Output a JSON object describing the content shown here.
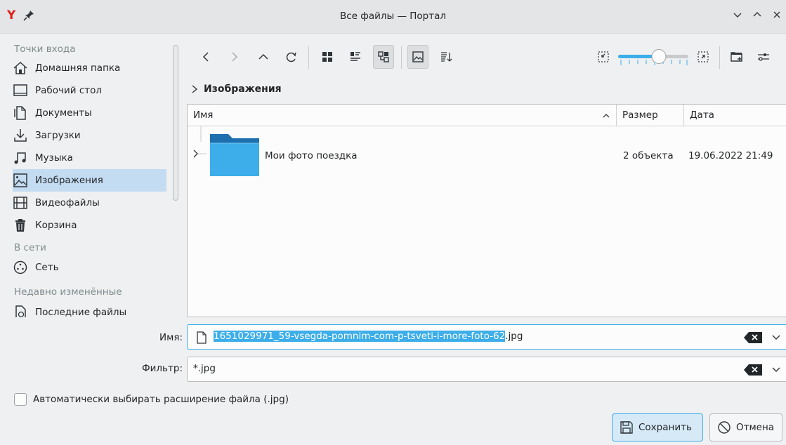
{
  "window": {
    "title": "Все файлы — Портал",
    "app_logo": "Y"
  },
  "sidebar": {
    "sections": [
      {
        "header": "Точки входа",
        "items": [
          {
            "label": "Домашняя папка",
            "icon": "home-icon"
          },
          {
            "label": "Рабочий стол",
            "icon": "desktop-icon"
          },
          {
            "label": "Документы",
            "icon": "documents-icon"
          },
          {
            "label": "Загрузки",
            "icon": "downloads-icon"
          },
          {
            "label": "Музыка",
            "icon": "music-icon"
          },
          {
            "label": "Изображения",
            "icon": "pictures-icon",
            "active": true
          },
          {
            "label": "Видеофайлы",
            "icon": "videos-icon"
          },
          {
            "label": "Корзина",
            "icon": "trash-icon"
          }
        ]
      },
      {
        "header": "В сети",
        "items": [
          {
            "label": "Сеть",
            "icon": "network-icon"
          }
        ]
      },
      {
        "header": "Недавно изменённые",
        "items": [
          {
            "label": "Последние файлы",
            "icon": "recent-files-icon"
          }
        ]
      }
    ]
  },
  "breadcrumb": {
    "current": "Изображения"
  },
  "fileview": {
    "columns": [
      "Имя",
      "Размер",
      "Дата"
    ],
    "rows": [
      {
        "name": "Мои фото поездка",
        "size": "2 объекта",
        "date": "19.06.2022 21:49",
        "icon": "folder-icon"
      }
    ]
  },
  "form": {
    "name_label": "Имя:",
    "name_selected": "1651029971_59-vsegda-pomnim-com-p-tsveti-i-more-foto-62",
    "name_extension": ".jpg",
    "filter_label": "Фильтр:",
    "filter_value": "*.jpg",
    "auto_extension_label": "Автоматически выбирать расширение файла (.jpg)",
    "auto_extension_checked": false
  },
  "buttons": {
    "save": "Сохранить",
    "cancel": "Отмена"
  },
  "colors": {
    "accent": "#3daee9",
    "selection_bg": "#c4dcf2",
    "folder": "#3daee9",
    "logo": "#e0201b"
  }
}
